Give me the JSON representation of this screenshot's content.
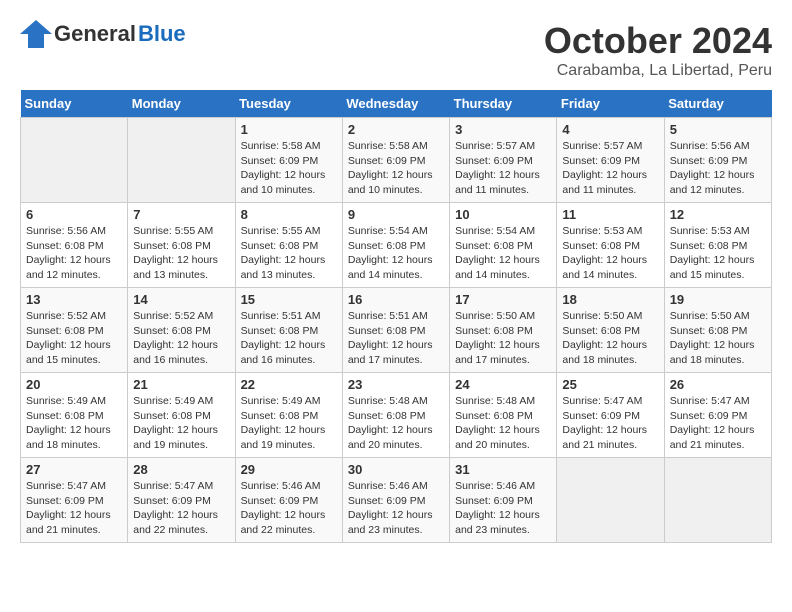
{
  "header": {
    "logo": {
      "general": "General",
      "blue": "Blue"
    },
    "title": "October 2024",
    "subtitle": "Carabamba, La Libertad, Peru"
  },
  "weekdays": [
    "Sunday",
    "Monday",
    "Tuesday",
    "Wednesday",
    "Thursday",
    "Friday",
    "Saturday"
  ],
  "weeks": [
    [
      {
        "day": "",
        "info": ""
      },
      {
        "day": "",
        "info": ""
      },
      {
        "day": "1",
        "info": "Sunrise: 5:58 AM\nSunset: 6:09 PM\nDaylight: 12 hours\nand 10 minutes."
      },
      {
        "day": "2",
        "info": "Sunrise: 5:58 AM\nSunset: 6:09 PM\nDaylight: 12 hours\nand 10 minutes."
      },
      {
        "day": "3",
        "info": "Sunrise: 5:57 AM\nSunset: 6:09 PM\nDaylight: 12 hours\nand 11 minutes."
      },
      {
        "day": "4",
        "info": "Sunrise: 5:57 AM\nSunset: 6:09 PM\nDaylight: 12 hours\nand 11 minutes."
      },
      {
        "day": "5",
        "info": "Sunrise: 5:56 AM\nSunset: 6:09 PM\nDaylight: 12 hours\nand 12 minutes."
      }
    ],
    [
      {
        "day": "6",
        "info": "Sunrise: 5:56 AM\nSunset: 6:08 PM\nDaylight: 12 hours\nand 12 minutes."
      },
      {
        "day": "7",
        "info": "Sunrise: 5:55 AM\nSunset: 6:08 PM\nDaylight: 12 hours\nand 13 minutes."
      },
      {
        "day": "8",
        "info": "Sunrise: 5:55 AM\nSunset: 6:08 PM\nDaylight: 12 hours\nand 13 minutes."
      },
      {
        "day": "9",
        "info": "Sunrise: 5:54 AM\nSunset: 6:08 PM\nDaylight: 12 hours\nand 14 minutes."
      },
      {
        "day": "10",
        "info": "Sunrise: 5:54 AM\nSunset: 6:08 PM\nDaylight: 12 hours\nand 14 minutes."
      },
      {
        "day": "11",
        "info": "Sunrise: 5:53 AM\nSunset: 6:08 PM\nDaylight: 12 hours\nand 14 minutes."
      },
      {
        "day": "12",
        "info": "Sunrise: 5:53 AM\nSunset: 6:08 PM\nDaylight: 12 hours\nand 15 minutes."
      }
    ],
    [
      {
        "day": "13",
        "info": "Sunrise: 5:52 AM\nSunset: 6:08 PM\nDaylight: 12 hours\nand 15 minutes."
      },
      {
        "day": "14",
        "info": "Sunrise: 5:52 AM\nSunset: 6:08 PM\nDaylight: 12 hours\nand 16 minutes."
      },
      {
        "day": "15",
        "info": "Sunrise: 5:51 AM\nSunset: 6:08 PM\nDaylight: 12 hours\nand 16 minutes."
      },
      {
        "day": "16",
        "info": "Sunrise: 5:51 AM\nSunset: 6:08 PM\nDaylight: 12 hours\nand 17 minutes."
      },
      {
        "day": "17",
        "info": "Sunrise: 5:50 AM\nSunset: 6:08 PM\nDaylight: 12 hours\nand 17 minutes."
      },
      {
        "day": "18",
        "info": "Sunrise: 5:50 AM\nSunset: 6:08 PM\nDaylight: 12 hours\nand 18 minutes."
      },
      {
        "day": "19",
        "info": "Sunrise: 5:50 AM\nSunset: 6:08 PM\nDaylight: 12 hours\nand 18 minutes."
      }
    ],
    [
      {
        "day": "20",
        "info": "Sunrise: 5:49 AM\nSunset: 6:08 PM\nDaylight: 12 hours\nand 18 minutes."
      },
      {
        "day": "21",
        "info": "Sunrise: 5:49 AM\nSunset: 6:08 PM\nDaylight: 12 hours\nand 19 minutes."
      },
      {
        "day": "22",
        "info": "Sunrise: 5:49 AM\nSunset: 6:08 PM\nDaylight: 12 hours\nand 19 minutes."
      },
      {
        "day": "23",
        "info": "Sunrise: 5:48 AM\nSunset: 6:08 PM\nDaylight: 12 hours\nand 20 minutes."
      },
      {
        "day": "24",
        "info": "Sunrise: 5:48 AM\nSunset: 6:08 PM\nDaylight: 12 hours\nand 20 minutes."
      },
      {
        "day": "25",
        "info": "Sunrise: 5:47 AM\nSunset: 6:09 PM\nDaylight: 12 hours\nand 21 minutes."
      },
      {
        "day": "26",
        "info": "Sunrise: 5:47 AM\nSunset: 6:09 PM\nDaylight: 12 hours\nand 21 minutes."
      }
    ],
    [
      {
        "day": "27",
        "info": "Sunrise: 5:47 AM\nSunset: 6:09 PM\nDaylight: 12 hours\nand 21 minutes."
      },
      {
        "day": "28",
        "info": "Sunrise: 5:47 AM\nSunset: 6:09 PM\nDaylight: 12 hours\nand 22 minutes."
      },
      {
        "day": "29",
        "info": "Sunrise: 5:46 AM\nSunset: 6:09 PM\nDaylight: 12 hours\nand 22 minutes."
      },
      {
        "day": "30",
        "info": "Sunrise: 5:46 AM\nSunset: 6:09 PM\nDaylight: 12 hours\nand 23 minutes."
      },
      {
        "day": "31",
        "info": "Sunrise: 5:46 AM\nSunset: 6:09 PM\nDaylight: 12 hours\nand 23 minutes."
      },
      {
        "day": "",
        "info": ""
      },
      {
        "day": "",
        "info": ""
      }
    ]
  ]
}
